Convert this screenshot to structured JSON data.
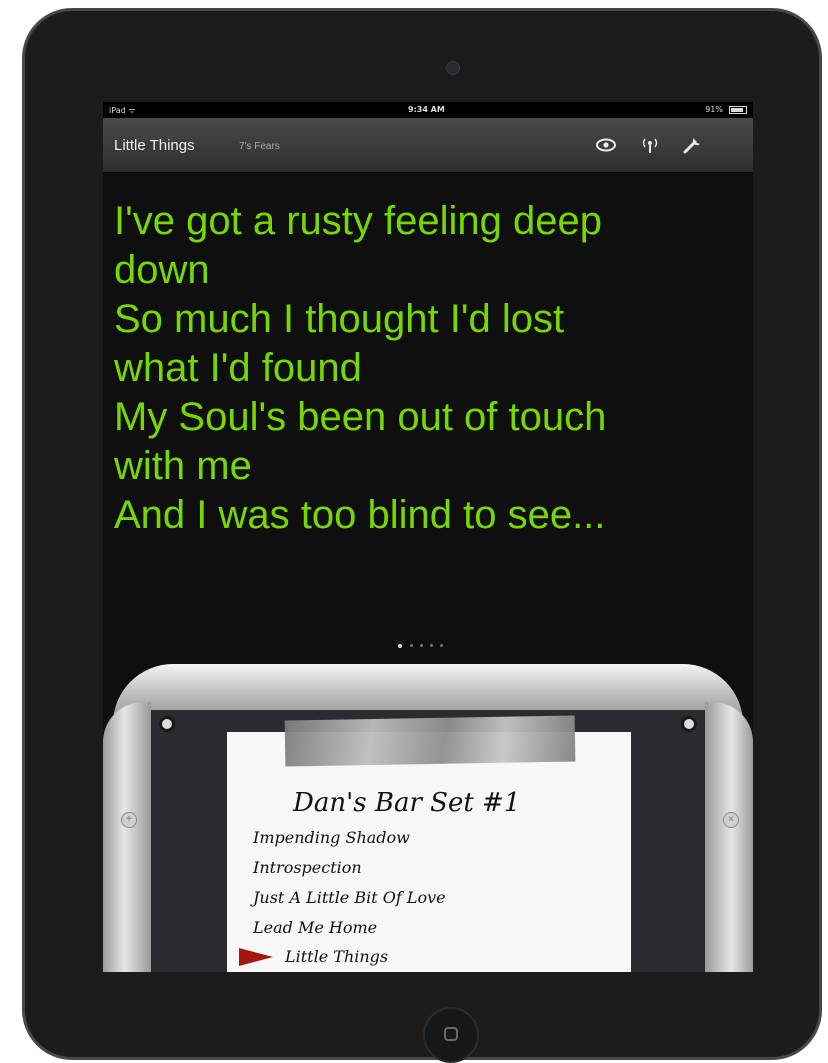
{
  "status_bar": {
    "carrier": "iPad ᯤ",
    "time": "9:34 AM",
    "battery": "91%"
  },
  "nav": {
    "song_title": "Little Things",
    "artist": "7's Fears",
    "icons": [
      "eye-icon",
      "broadcast-icon",
      "wrench-icon"
    ]
  },
  "lyrics": {
    "lines": [
      "I've got a rusty feeling deep",
      "down",
      "So much I thought I'd lost",
      "what I'd found",
      "My Soul's been out of touch",
      "with me",
      "And I was too blind to see..."
    ],
    "color": "#76d800"
  },
  "pager": {
    "page_count": 5,
    "current_page": 1
  },
  "setlist": {
    "title": "Dan's Bar Set #1",
    "items": [
      "Impending Shadow",
      "Introspection",
      "Just A Little Bit Of Love",
      "Lead Me Home",
      "Little Things"
    ],
    "current_item": "Little Things",
    "arrow_color": "#a31612"
  }
}
